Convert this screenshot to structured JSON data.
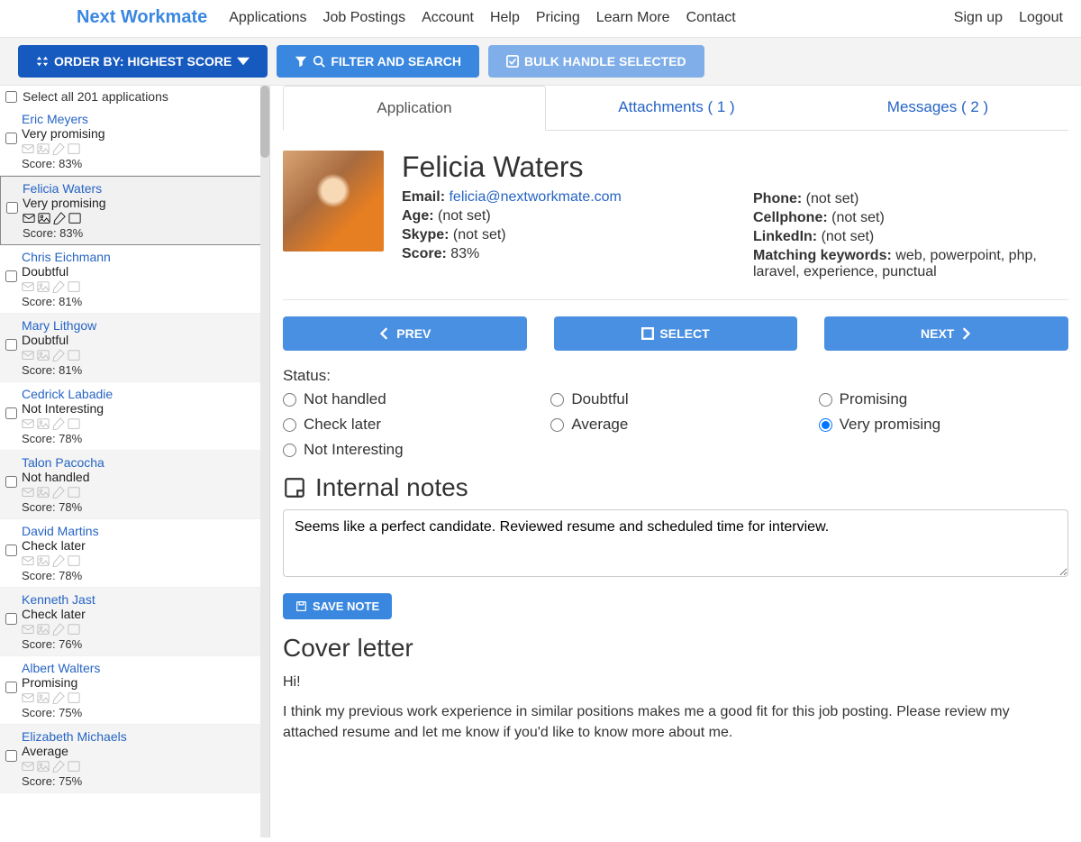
{
  "brand": "Next Workmate",
  "nav": [
    "Applications",
    "Job Postings",
    "Account",
    "Help",
    "Pricing",
    "Learn More",
    "Contact"
  ],
  "navRight": [
    "Sign up",
    "Logout"
  ],
  "toolbar": {
    "order": "ORDER BY: HIGHEST SCORE",
    "filter": "FILTER AND SEARCH",
    "bulk": "BULK HANDLE SELECTED"
  },
  "selectAll": "Select all 201 applications",
  "applicants": [
    {
      "name": "Eric Meyers",
      "status": "Very promising",
      "score": "Score: 83%"
    },
    {
      "name": "Felicia Waters",
      "status": "Very promising",
      "score": "Score: 83%",
      "active": true
    },
    {
      "name": "Chris Eichmann",
      "status": "Doubtful",
      "score": "Score: 81%"
    },
    {
      "name": "Mary Lithgow",
      "status": "Doubtful",
      "score": "Score: 81%"
    },
    {
      "name": "Cedrick Labadie",
      "status": "Not Interesting",
      "score": "Score: 78%"
    },
    {
      "name": "Talon Pacocha",
      "status": "Not handled",
      "score": "Score: 78%"
    },
    {
      "name": "David Martins",
      "status": "Check later",
      "score": "Score: 78%"
    },
    {
      "name": "Kenneth Jast",
      "status": "Check later",
      "score": "Score: 76%"
    },
    {
      "name": "Albert Walters",
      "status": "Promising",
      "score": "Score: 75%"
    },
    {
      "name": "Elizabeth Michaels",
      "status": "Average",
      "score": "Score: 75%"
    }
  ],
  "tabs": {
    "application": "Application",
    "attachments": "Attachments ( 1 )",
    "messages": "Messages ( 2 )"
  },
  "profile": {
    "name": "Felicia Waters",
    "emailLabel": "Email:",
    "email": "felicia@nextworkmate.com",
    "ageLabel": "Age:",
    "age": "(not set)",
    "skypeLabel": "Skype:",
    "skype": "(not set)",
    "scoreLabel": "Score:",
    "score": "83%",
    "phoneLabel": "Phone:",
    "phone": "(not set)",
    "cellLabel": "Cellphone:",
    "cell": "(not set)",
    "linkedinLabel": "LinkedIn:",
    "linkedin": "(not set)",
    "keywordsLabel": "Matching keywords:",
    "keywords": "web, powerpoint, php, laravel, experience, punctual"
  },
  "navBtns": {
    "prev": "PREV",
    "select": "SELECT",
    "next": "NEXT"
  },
  "statusLabel": "Status:",
  "statuses": [
    "Not handled",
    "Doubtful",
    "Promising",
    "Check later",
    "Average",
    "Very promising",
    "Not Interesting"
  ],
  "statusSelected": "Very promising",
  "notesHeading": "Internal notes",
  "notes": "Seems like a perfect candidate. Reviewed resume and scheduled time for interview.",
  "saveNote": "SAVE NOTE",
  "coverHeading": "Cover letter",
  "coverP1": "Hi!",
  "coverP2": "I think my previous work experience in similar positions makes me a good fit for this job posting. Please review my attached resume and let me know if you'd like to know more about me."
}
